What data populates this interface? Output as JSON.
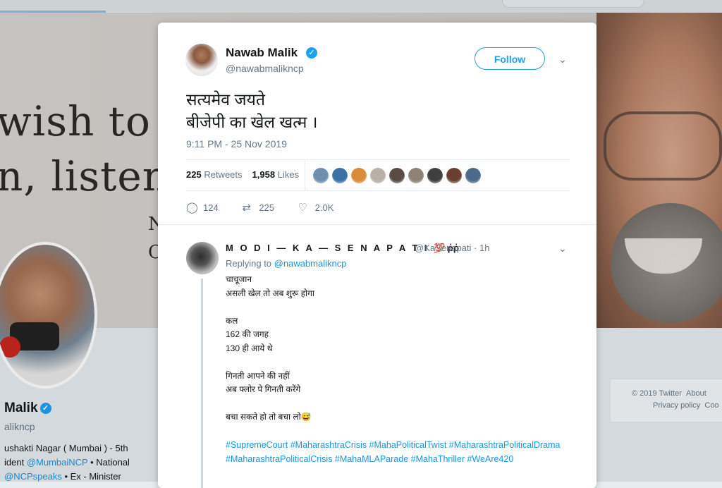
{
  "background": {
    "banner_text_lines": [
      "wish to l",
      "n, listen",
      "N",
      "C"
    ],
    "profile_name": "Malik",
    "profile_handle": "alikncp",
    "bio": {
      "line1": "ushakti Nagar ( Mumbai ) - 5th",
      "line2_pre": "ident ",
      "line2_link": "@MumbaiNCP",
      "line2_post": " • National",
      "line3_link": "@NCPspeaks",
      "line3_post": " • Ex - Minister"
    },
    "footer": {
      "copyright": "© 2019 Twitter",
      "about": "About",
      "privacy": "Privacy policy",
      "cookies": "Coo"
    }
  },
  "tweet": {
    "author_name": "Nawab Malik",
    "author_handle": "@nawabmalikncp",
    "verified_glyph": "✓",
    "follow_label": "Follow",
    "caret": "⌄",
    "text": "सत्यमेव जयते\nबीजेपी का खेल खत्म ।",
    "time": "9:11 PM - 25 Nov 2019",
    "retweets_count": "225",
    "retweets_label": "Retweets",
    "likes_count": "1,958",
    "likes_label": "Likes",
    "liker_colors": [
      "#6d8fb0",
      "#3a6fa8",
      "#d98b3a",
      "#b9b0a8",
      "#5a4a45",
      "#8d8275",
      "#3f3f3f",
      "#6b3f2f",
      "#4b6a87"
    ],
    "actions": {
      "reply_glyph": "◯",
      "reply_count": "124",
      "retweet_glyph": "⇄",
      "retweet_count": "225",
      "like_glyph": "♡",
      "like_count": "2.0K"
    }
  },
  "reply": {
    "name": "M O D I — K A — S E N A P A T I",
    "emoji": "💯 ῤῤ",
    "handle_time": "@KaSenapati · 1h",
    "caret": "⌄",
    "replying_label": "Replying to ",
    "replying_link": "@nawabmalikncp",
    "text": "चाचूजान\nअसली खेल तो अब शुरू होगा\n\nकल\n162 की जगह\n130 ही आये थे\n\nगिनती आपने की नहीं\nअब फ्लोर पे गिनती करेंगे\n\nबचा सकते हो तो बचा लो😅",
    "hashtags": "#SupremeCourt #MaharashtraCrisis #MahaPoliticalTwist #MaharashtraPoliticalDrama #MaharashtraPoliticalCrisis #MahaMLAParade #MahaThriller #WeAre420"
  }
}
